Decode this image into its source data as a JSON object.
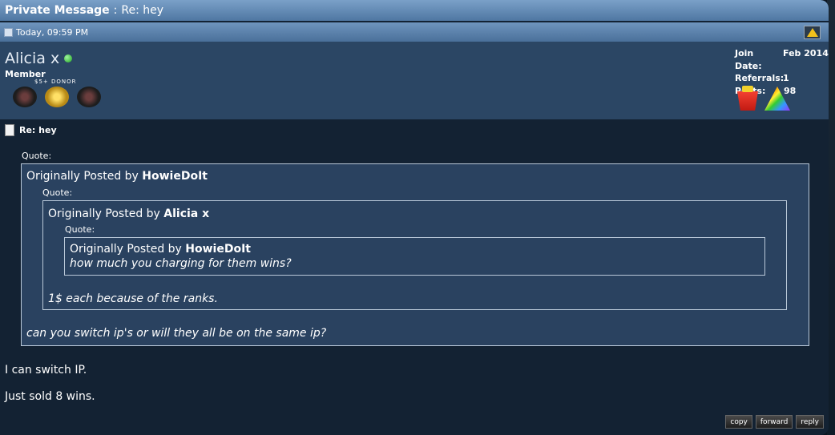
{
  "title": {
    "label": "Private Message",
    "subject": "Re: hey"
  },
  "post": {
    "date": "Today, 09:59 PM"
  },
  "user": {
    "name": "Alicia x",
    "title": "Member",
    "donor_label": "$5+ DONOR",
    "stats": [
      {
        "label": "Join Date:",
        "value": "Feb 2014"
      },
      {
        "label": "Referrals:",
        "value": "1"
      },
      {
        "label": "Posts:",
        "value": "98"
      }
    ]
  },
  "message": {
    "subject": "Re: hey",
    "quote_label": "Quote:",
    "originally_posted_by": "Originally Posted by",
    "quote1": {
      "author": "HowieDoIt",
      "text": "can you switch ip's or will they all be on the same ip?"
    },
    "quote2": {
      "author": "Alicia x",
      "text": "1$ each because of the ranks."
    },
    "quote3": {
      "author": "HowieDoIt",
      "text": "how much you charging for them wins?"
    },
    "lines": [
      "I can switch IP.",
      "Just sold 8 wins."
    ]
  },
  "actions": {
    "copy": "copy",
    "forward": "forward",
    "reply": "reply"
  },
  "icons": {
    "online": "online-status-icon",
    "report": "report-post-icon"
  },
  "colors": {
    "titlebar": "#5f88b3",
    "userbar": "#2b4664",
    "quote_bg": "#2a4260",
    "page_bg": "#132233"
  }
}
